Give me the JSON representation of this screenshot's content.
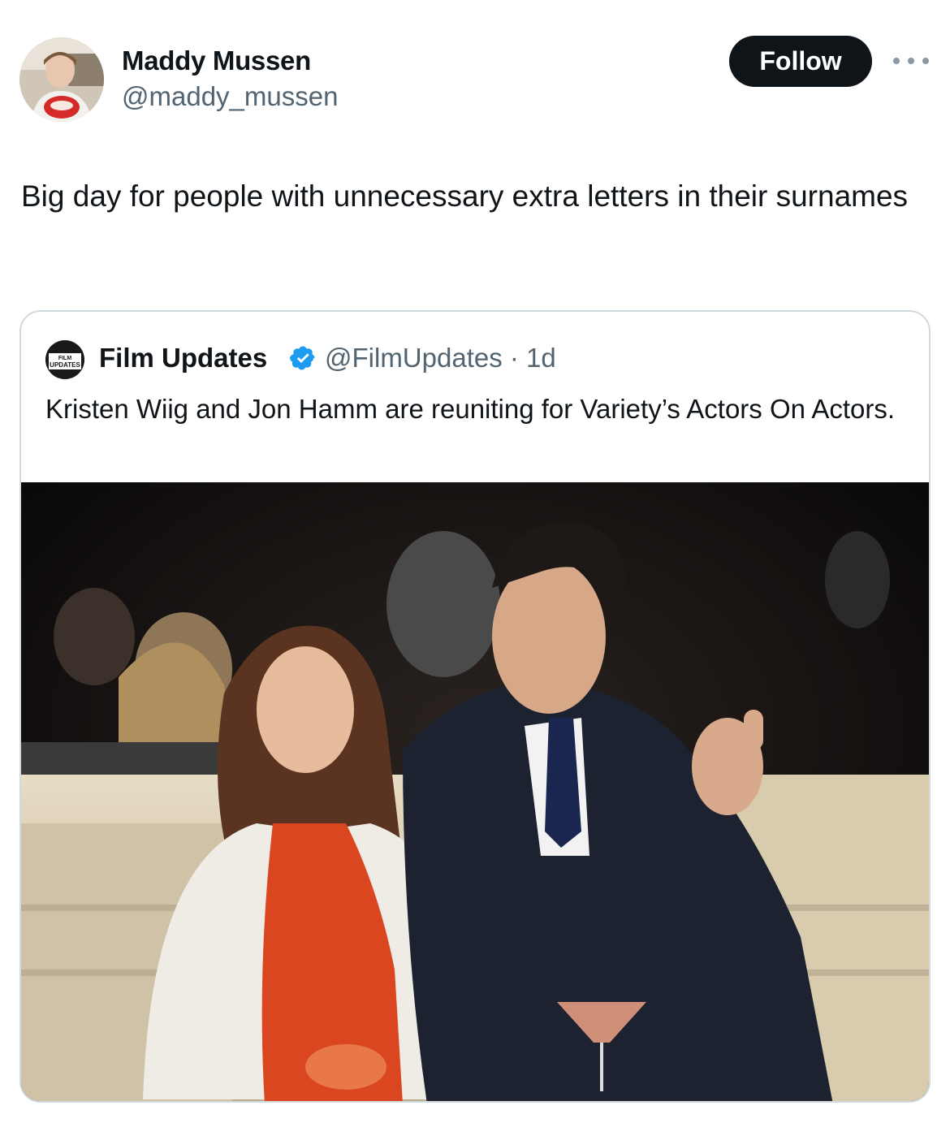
{
  "author": {
    "name": "Maddy Mussen",
    "handle": "@maddy_mussen"
  },
  "actions": {
    "follow_label": "Follow",
    "more_icon": "more-horizontal-icon"
  },
  "tweet": {
    "text": "Big day for people with unnecessary extra letters in their surnames"
  },
  "quoted_tweet": {
    "author_name": "Film Updates",
    "handle_and_time": "@FilmUpdates · 1d",
    "verified_icon": "verified-badge-icon",
    "avatar_logo_text": "FILM UPDATES",
    "text": "Kristen Wiig and Jon Hamm are reuniting for Variety’s Actors On Actors."
  },
  "colors": {
    "text": "#0f1419",
    "secondary_text": "#536471",
    "follow_button_bg": "#0f1419",
    "verified_blue": "#1d9bf0",
    "border": "#cfd9de"
  }
}
